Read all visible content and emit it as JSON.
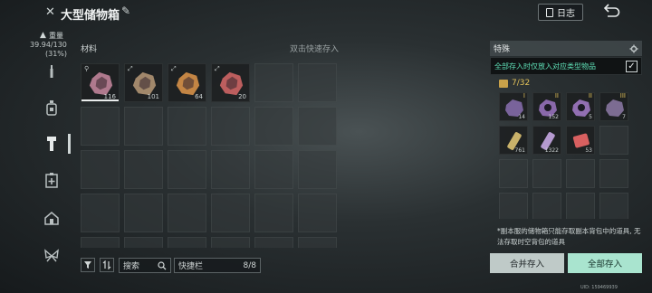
{
  "header": {
    "title": "大型储物箱",
    "log_label": "日志"
  },
  "sidebar": {
    "weight_label": "重量",
    "weight_value": "39.94/130",
    "weight_percent": "(31%)"
  },
  "inventory": {
    "section_label": "材料",
    "double_click_hint": "双击快速存入",
    "items": [
      {
        "count": "116",
        "icon": "ore-crystal-icon",
        "color": "#c98aa0"
      },
      {
        "count": "101",
        "icon": "bronze-ore-icon",
        "color": "#b89a78"
      },
      {
        "count": "64",
        "icon": "fire-crystal-icon",
        "color": "#e0964a"
      },
      {
        "count": "20",
        "icon": "red-crystal-icon",
        "color": "#d86868"
      }
    ]
  },
  "toolbar": {
    "search_label": "搜索",
    "quickbar_label": "快捷栏",
    "quickbar_count": "8/8"
  },
  "special": {
    "header_label": "特殊",
    "option_label": "全部存入时仅放入对应类型物品",
    "checked": true,
    "capacity": "7/32",
    "items": [
      {
        "count": "14",
        "rank": "I",
        "icon": "purple-ore-icon",
        "color": "#8a6fb0"
      },
      {
        "count": "152",
        "rank": "II",
        "icon": "purple-ring-ore-icon",
        "color": "#9c74c2"
      },
      {
        "count": "5",
        "rank": "II",
        "icon": "purple-ring-ore-icon",
        "color": "#a77ccb"
      },
      {
        "count": "7",
        "rank": "III",
        "icon": "dark-ore-icon",
        "color": "#8d7aa6"
      },
      {
        "count": "761",
        "rank": "",
        "icon": "gold-vial-icon",
        "color": "#c9b26a"
      },
      {
        "count": "1322",
        "rank": "",
        "icon": "purple-vial-icon",
        "color": "#b59ad0"
      },
      {
        "count": "53",
        "rank": "",
        "icon": "red-card-icon",
        "color": "#d86060"
      }
    ],
    "note": "*副本服的储物箱只能存取副本背包中的道具, 无法存取时空背包的道具",
    "merge_label": "合并存入",
    "all_label": "全部存入"
  },
  "footer": {
    "uid": "UID: 159469939"
  },
  "colors": {
    "accent_green": "#5fe0b7",
    "gold": "#e2c25a",
    "all_button": "#a9e4cf"
  }
}
